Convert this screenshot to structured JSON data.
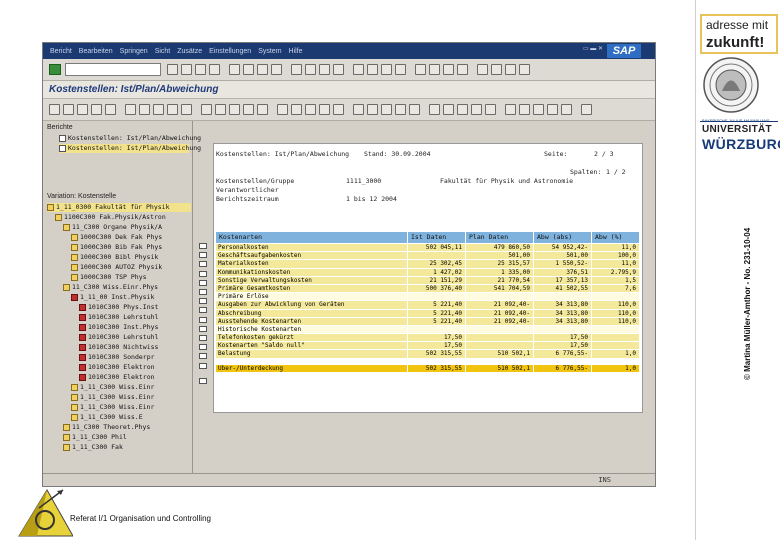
{
  "sap": {
    "menu": [
      "Bericht",
      "Bearbeiten",
      "Springen",
      "Sicht",
      "Zusätze",
      "Einstellungen",
      "System",
      "Hilfe"
    ],
    "title": "Kostenstellen: Ist/Plan/Abweichung",
    "logo": "SAP",
    "nav": {
      "reports_title": "Berichte",
      "reports": [
        "Kostenstellen: Ist/Plan/Abweichung",
        "Kostenstellen: Ist/Plan/Abweichung"
      ],
      "variation_title": "Variation: Kostenstelle",
      "tree": [
        "1_11_0300 Fakultät für Physik",
        "1100C300 Fak.Physik/Astron",
        "11_C300 Organe Physik/A",
        "1000C300 Dek Fak Phys",
        "1000C300 Bib Fak Phys",
        "1000C300 Bibl Physik",
        "1000C300 AUTOZ Physik",
        "1000C300 TSP Phys",
        "11_C300 Wiss.Einr.Phys",
        "1_11_00 Inst.Physik",
        "1010C300 Phys.Inst",
        "1010C300 Lehrstuhl",
        "1010C300 Inst.Phys",
        "1010C300 Lehrstuhl",
        "1010C300 Nichtwiss",
        "1010C300 Sonderpr",
        "1010C300 Elektron",
        "1010C300 Elektron",
        "1_11_C300 Wiss.Einr",
        "1_11_C300 Wiss.Einr",
        "1_11_C300 Wiss.Einr",
        "1_11_C300 Wiss.E",
        "11_C300 Theoret.Phys",
        "1_11_C300 Phil",
        "1_11_C300 Fak"
      ]
    },
    "report": {
      "header": {
        "line1_label": "Kostenstellen: Ist/Plan/Abweichung",
        "line1_status": "Stand: 30.09.2004",
        "page_label": "Seite:",
        "page_value": "2 / 3",
        "spalten_label": "Spalten:",
        "spalten_value": "1 / 2",
        "gruppe_label": "Kostenstellen/Gruppe",
        "gruppe_value": "1111_3000",
        "gruppe_desc": "Fakultät für Physik und Astronomie",
        "verantw_label": "Verantwortlicher",
        "periode_label": "Berichtszeitraum",
        "periode_value": "1 bis 12 2004"
      },
      "columns": [
        "Kostenarten",
        "Ist Daten",
        "Plan Daten",
        "Abw (abs)",
        "Abw (%)"
      ],
      "rows": [
        {
          "name": "Personalkosten",
          "ist": "502 045,11",
          "plan": "479 860,50",
          "abs": "54 952,42-",
          "pct": "11,0"
        },
        {
          "name": "Geschäftsaufgabenkosten",
          "ist": "",
          "plan": "501,00",
          "abs": "501,00",
          "pct": "100,0"
        },
        {
          "name": "Materialkosten",
          "ist": "25 302,45",
          "plan": "25 315,57",
          "abs": "1 550,52-",
          "pct": "11,0"
        },
        {
          "name": "Kommunikationskosten",
          "ist": "1 427,02",
          "plan": "1 335,00",
          "abs": "376,51",
          "pct": "2.795,9"
        },
        {
          "name": "Sonstige Verwaltungskosten",
          "ist": "21 151,29",
          "plan": "21 770,54",
          "abs": "17 357,13",
          "pct": "1,5"
        },
        {
          "name": "Primäre Gesamtkosten",
          "ist": "500 376,40",
          "plan": "541 704,59",
          "abs": "41 502,55",
          "pct": "7,6"
        },
        {
          "name": "Primäre Erlöse",
          "ist": "",
          "plan": "",
          "abs": "",
          "pct": ""
        },
        {
          "name": "Ausgaben zur Abwicklung von Geräten",
          "ist": "5 221,40",
          "plan": "21 092,40-",
          "abs": "34 313,80",
          "pct": "110,0"
        },
        {
          "name": "Abschreibung",
          "ist": "5 221,40",
          "plan": "21 092,40-",
          "abs": "34 313,80",
          "pct": "110,0"
        },
        {
          "name": "Ausstehende Kostenarten",
          "ist": "5 221,40",
          "plan": "21 092,40-",
          "abs": "34 313,80",
          "pct": "110,0"
        },
        {
          "name": "Historische Kostenarten",
          "ist": "",
          "plan": "",
          "abs": "",
          "pct": ""
        },
        {
          "name": "Telefonkosten gekürzt",
          "ist": "17,50",
          "plan": "",
          "abs": "17,50",
          "pct": ""
        },
        {
          "name": "Kostenarten \"Saldo null\"",
          "ist": "17,50",
          "plan": "",
          "abs": "17,50",
          "pct": ""
        },
        {
          "name": "Belastung",
          "ist": "502 315,55",
          "plan": "510 502,1",
          "abs": "6 776,55-",
          "pct": "1,0"
        }
      ],
      "total": {
        "name": "Über-/Unterdeckung",
        "ist": "502 315,55",
        "plan": "510 502,1",
        "abs": "6 776,55-",
        "pct": "1,0"
      }
    },
    "status": {
      "system": "INS"
    }
  },
  "footer": {
    "text": "Referat I/1 Organisation und Controlling"
  },
  "branding": {
    "line1": "adresse mit",
    "line2": "zukunft!",
    "uni_small": "BAYERISCHE JULIUS-MAXIMILIANS-",
    "uni1": "UNIVERSITÄT",
    "uni2": "WÜRZBURG",
    "copyright": "© Martina Müller-Amthor - No. 231-10-04"
  },
  "colors": {
    "menubar": "#1c3a72",
    "header": "#7fb2dc",
    "row": "#f4e99a",
    "total": "#f1c40f",
    "brand_border": "#e8c35a",
    "uni": "#173b78"
  }
}
